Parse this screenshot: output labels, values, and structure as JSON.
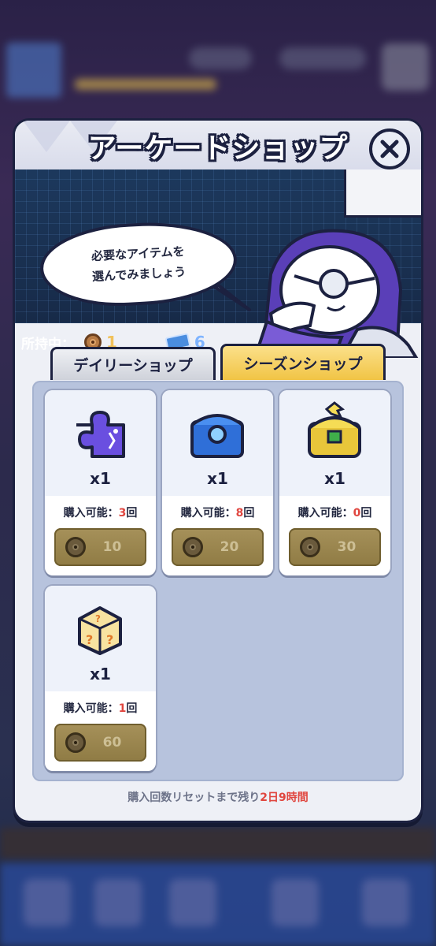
{
  "modal": {
    "title": "アーケードショップ",
    "close_icon": "close-icon"
  },
  "npc": {
    "speech_line1": "必要なアイテムを",
    "speech_line2": "選んでみましょう"
  },
  "owned": {
    "label": "所持中：",
    "coins": "1",
    "tickets": "6"
  },
  "tabs": [
    {
      "label": "デイリーショップ",
      "active": false
    },
    {
      "label": "シーズンショップ",
      "active": true
    }
  ],
  "items": [
    {
      "icon": "puzzle-piece-icon",
      "qty": "x1",
      "avail_prefix": "購入可能：",
      "avail_num": "3",
      "avail_suffix": "回",
      "price": "10"
    },
    {
      "icon": "blue-chest-icon",
      "qty": "x1",
      "avail_prefix": "購入可能：",
      "avail_num": "8",
      "avail_suffix": "回",
      "price": "20"
    },
    {
      "icon": "gold-chest-icon",
      "qty": "x1",
      "avail_prefix": "購入可能：",
      "avail_num": "0",
      "avail_suffix": "回",
      "price": "30"
    },
    {
      "icon": "mystery-dice-icon",
      "qty": "x1",
      "avail_prefix": "購入可能：",
      "avail_num": "1",
      "avail_suffix": "回",
      "price": "60"
    }
  ],
  "reset": {
    "prefix": "購入回数リセットまで残り",
    "highlight": "2日9時間"
  },
  "colors": {
    "accent_red": "#e0463f",
    "tab_active": "#f1c445",
    "outline": "#1c2140"
  }
}
